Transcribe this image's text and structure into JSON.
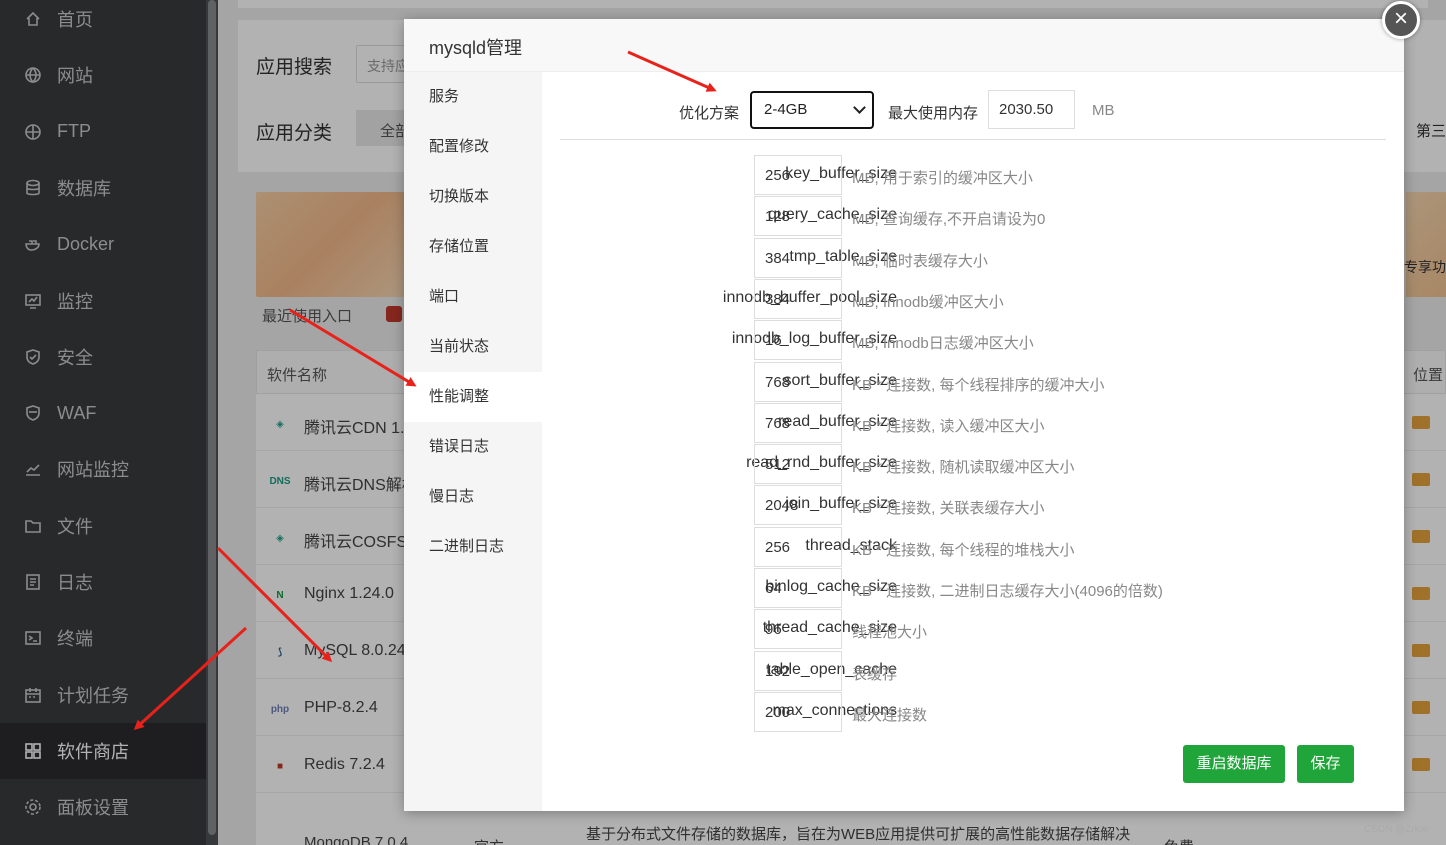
{
  "sidebar": {
    "items": [
      {
        "label": "首页",
        "icon": "home-icon"
      },
      {
        "label": "网站",
        "icon": "globe-icon"
      },
      {
        "label": "FTP",
        "icon": "ftp-icon"
      },
      {
        "label": "数据库",
        "icon": "database-icon"
      },
      {
        "label": "Docker",
        "icon": "docker-icon"
      },
      {
        "label": "监控",
        "icon": "monitor-icon"
      },
      {
        "label": "安全",
        "icon": "shield-icon"
      },
      {
        "label": "WAF",
        "icon": "waf-icon"
      },
      {
        "label": "网站监控",
        "icon": "chart-icon"
      },
      {
        "label": "文件",
        "icon": "folder-icon"
      },
      {
        "label": "日志",
        "icon": "log-icon"
      },
      {
        "label": "终端",
        "icon": "terminal-icon"
      },
      {
        "label": "计划任务",
        "icon": "calendar-icon"
      },
      {
        "label": "软件商店",
        "icon": "grid-icon"
      },
      {
        "label": "面板设置",
        "icon": "gear-icon"
      }
    ],
    "active_index": 13
  },
  "page": {
    "search_label": "应用搜索",
    "search_placeholder": "支持应",
    "category_label": "应用分类",
    "category_tab": "全部",
    "category_right": "第三",
    "banner_right_text": "专享功",
    "recent_label": "最近使用入口",
    "table_header": {
      "name": "软件名称",
      "position": "位置"
    },
    "software": [
      {
        "name": "腾讯云CDN 1.0",
        "icon": "tencent-cdn-icon"
      },
      {
        "name": "腾讯云DNS解析",
        "icon": "dns-icon"
      },
      {
        "name": "腾讯云COSFS 2",
        "icon": "tencent-cosfs-icon"
      },
      {
        "name": "Nginx 1.24.0",
        "icon": "nginx-icon"
      },
      {
        "name": "MySQL 8.0.24",
        "icon": "mysql-icon"
      },
      {
        "name": "PHP-8.2.4",
        "icon": "php-icon"
      },
      {
        "name": "Redis 7.2.4",
        "icon": "redis-icon"
      }
    ],
    "bottom_row": {
      "name": "MongoDB 7.0.4",
      "type": "官方",
      "desc": "基于分布式文件存储的数据库，旨在为WEB应用提供可扩展的高性能数据存储解决",
      "fee": "免费"
    }
  },
  "dialog": {
    "title": "mysqld管理",
    "close": "×",
    "menu": [
      "服务",
      "配置修改",
      "切换版本",
      "存储位置",
      "端口",
      "当前状态",
      "性能调整",
      "错误日志",
      "慢日志",
      "二进制日志"
    ],
    "active_menu_index": 6,
    "optimize_label": "优化方案",
    "optimize_value": "2-4GB",
    "max_mem_label": "最大使用内存",
    "max_mem_value": "2030.50",
    "max_mem_unit": "MB",
    "params": [
      {
        "name": "key_buffer_size",
        "value": "256",
        "desc": "MB, 用于索引的缓冲区大小"
      },
      {
        "name": "query_cache_size",
        "value": "128",
        "desc": "MB, 查询缓存,不开启请设为0"
      },
      {
        "name": "tmp_table_size",
        "value": "384",
        "desc": "MB, 临时表缓存大小"
      },
      {
        "name": "innodb_buffer_pool_size",
        "value": "384",
        "desc": "MB, Innodb缓冲区大小"
      },
      {
        "name": "innodb_log_buffer_size",
        "value": "16",
        "desc": "MB, Innodb日志缓冲区大小"
      },
      {
        "name": "sort_buffer_size",
        "value": "768",
        "desc": "KB * 连接数, 每个线程排序的缓冲大小"
      },
      {
        "name": "read_buffer_size",
        "value": "768",
        "desc": "KB * 连接数, 读入缓冲区大小"
      },
      {
        "name": "read_rnd_buffer_size",
        "value": "512",
        "desc": "KB * 连接数, 随机读取缓冲区大小"
      },
      {
        "name": "join_buffer_size",
        "value": "2048",
        "desc": "KB * 连接数, 关联表缓存大小"
      },
      {
        "name": "thread_stack",
        "value": "256",
        "desc": "KB * 连接数, 每个线程的堆栈大小"
      },
      {
        "name": "binlog_cache_size",
        "value": "64",
        "desc": "KB * 连接数, 二进制日志缓存大小(4096的倍数)"
      },
      {
        "name": "thread_cache_size",
        "value": "96",
        "desc": "线程池大小"
      },
      {
        "name": "table_open_cache",
        "value": "192",
        "desc": "表缓存"
      },
      {
        "name": "max_connections",
        "value": "200",
        "desc": "最大连接数"
      }
    ],
    "restart_button": "重启数据库",
    "save_button": "保存"
  },
  "watermark": "CSDN @Zrlue",
  "colors": {
    "accent_green": "#20a53a",
    "arrow_red": "#e8221b",
    "sidebar_bg": "#3a3b3e"
  }
}
